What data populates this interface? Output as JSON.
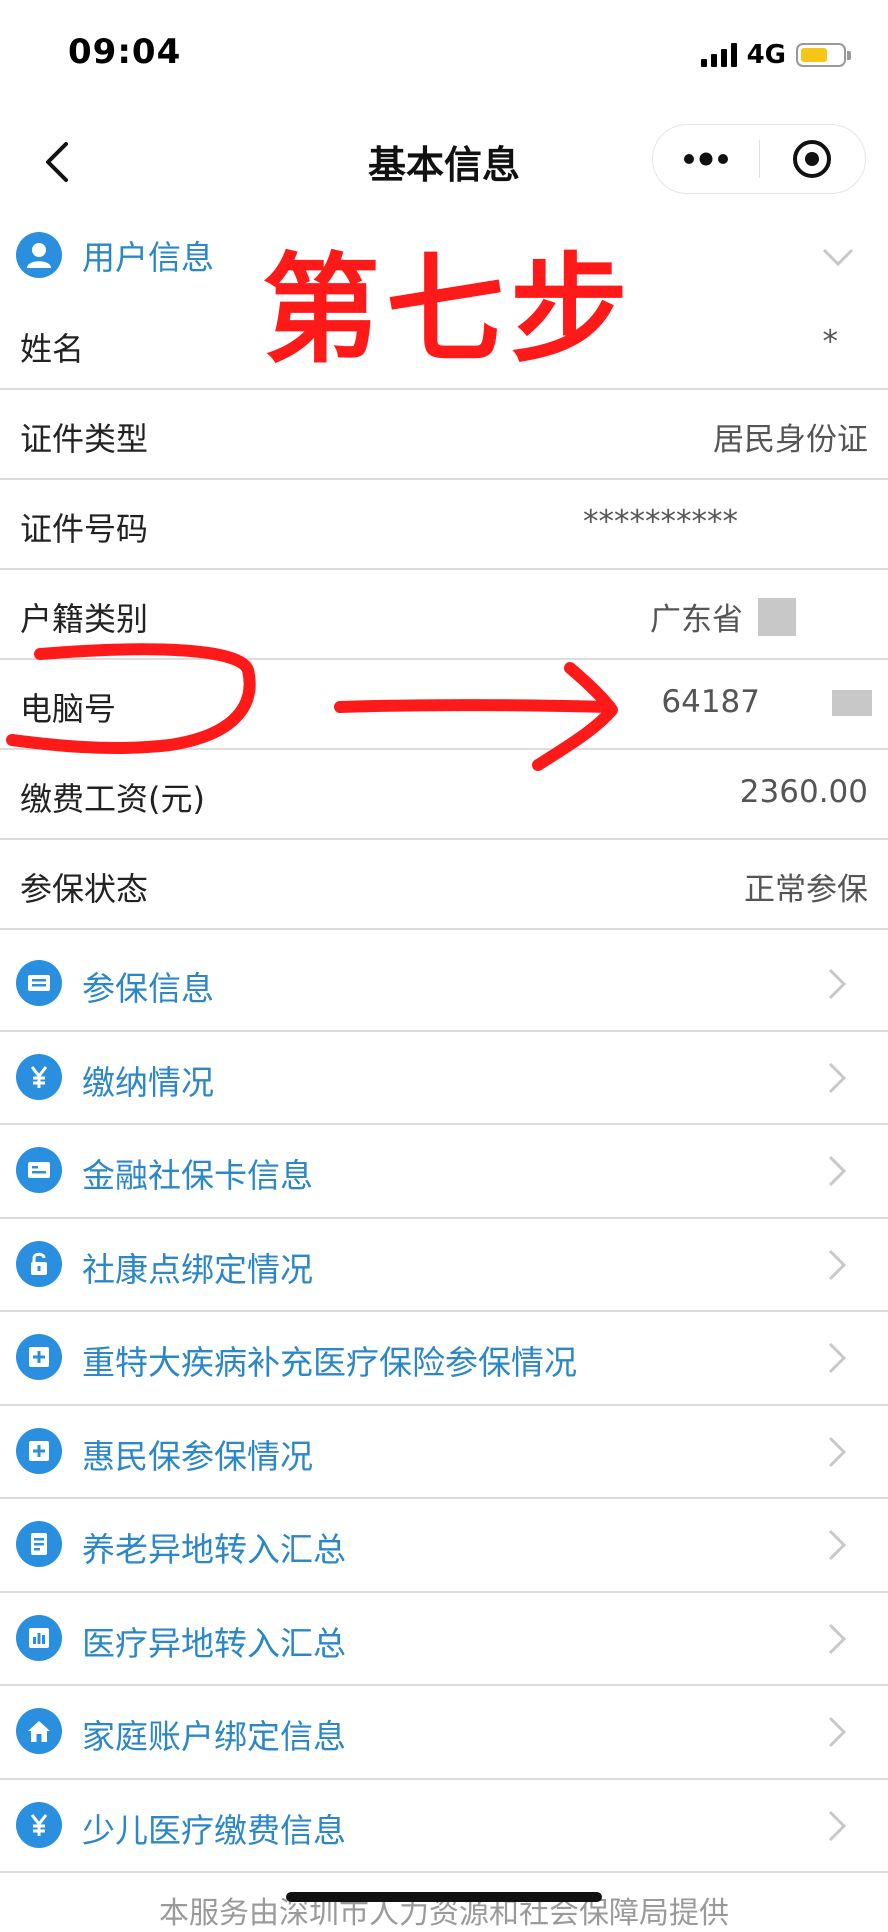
{
  "status_bar": {
    "time": "09:04",
    "network": "4G"
  },
  "nav": {
    "title": "基本信息"
  },
  "user_section": {
    "title": "用户信息"
  },
  "overlay": {
    "step_text": "第七步"
  },
  "info_rows": [
    {
      "label": "姓名",
      "value": "*"
    },
    {
      "label": "证件类型",
      "value": "居民身份证"
    },
    {
      "label": "证件号码",
      "value": "**********"
    },
    {
      "label": "户籍类别",
      "value": "广东省"
    },
    {
      "label": "电脑号",
      "value": "64187"
    },
    {
      "label": "缴费工资(元)",
      "value": "2360.00"
    },
    {
      "label": "参保状态",
      "value": "正常参保"
    }
  ],
  "menu_items": [
    {
      "label": "参保信息",
      "icon": "id-card-icon"
    },
    {
      "label": "缴纳情况",
      "icon": "yen-icon"
    },
    {
      "label": "金融社保卡信息",
      "icon": "card-icon"
    },
    {
      "label": "社康点绑定情况",
      "icon": "lock-icon"
    },
    {
      "label": "重特大疾病补充医疗保险参保情况",
      "icon": "medical-plus-icon"
    },
    {
      "label": "惠民保参保情况",
      "icon": "medical-plus-icon"
    },
    {
      "label": "养老异地转入汇总",
      "icon": "document-icon"
    },
    {
      "label": "医疗异地转入汇总",
      "icon": "bar-chart-icon"
    },
    {
      "label": "家庭账户绑定信息",
      "icon": "home-icon"
    },
    {
      "label": "少儿医疗缴费信息",
      "icon": "yen-icon"
    }
  ],
  "footer": {
    "text": "本服务由深圳市人力资源和社会保障局提供"
  },
  "colors": {
    "accent": "#2b87c8",
    "icon_bg": "#2b8fe0",
    "annotation": "#ff1a1a"
  }
}
